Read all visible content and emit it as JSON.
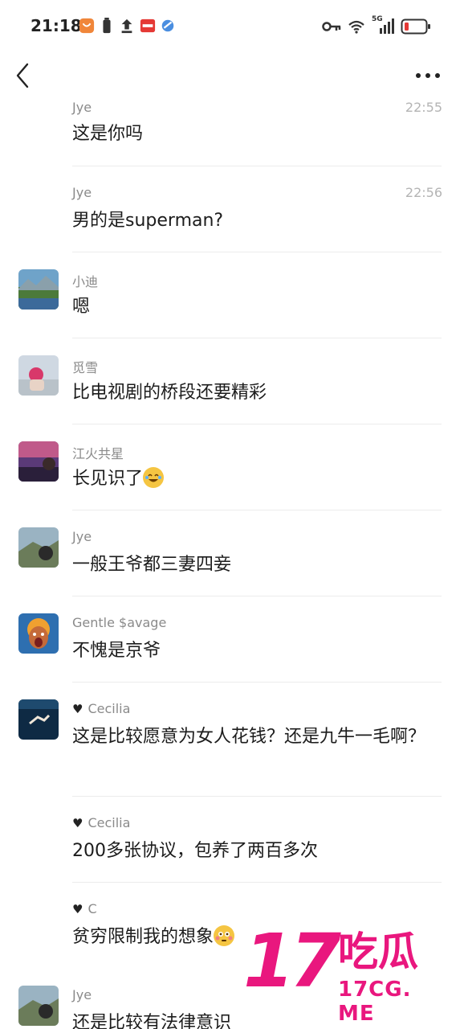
{
  "status_bar": {
    "time": "21:18",
    "network": "5G"
  },
  "nav": {
    "back_icon": "chevron-left-icon",
    "more_icon": "more-dots-icon"
  },
  "messages": [
    {
      "name": "Jye",
      "time": "22:55",
      "text": "这是你吗",
      "avatar": false,
      "heart": false
    },
    {
      "name": "Jye",
      "time": "22:56",
      "text": "男的是superman?",
      "avatar": false,
      "heart": false
    },
    {
      "name": "小迪",
      "text": "嗯",
      "avatar": true,
      "heart": false
    },
    {
      "name": "觅雪",
      "text": "比电视剧的桥段还要精彩",
      "avatar": true,
      "heart": false
    },
    {
      "name": "江火共星",
      "text": "长见识了",
      "emoji": "rolling-laughing-emoji",
      "avatar": true,
      "heart": false
    },
    {
      "name": "Jye",
      "text": "一般王爷都三妻四妾",
      "avatar": true,
      "heart": false
    },
    {
      "name": "Gentle $avage",
      "text": "不愧是京爷",
      "avatar": true,
      "heart": false
    },
    {
      "name": "Cecilia",
      "text": "这是比较愿意为女人花钱？还是九牛一毛啊？",
      "avatar": true,
      "heart": true
    },
    {
      "name": "Cecilia",
      "text": "200多张协议，包养了两百多次",
      "avatar": false,
      "heart": true
    },
    {
      "name": "C",
      "text": "贫穷限制我的想象",
      "emoji": "flushed-emoji",
      "avatar": false,
      "heart": true
    },
    {
      "name": "Jye",
      "text": "还是比较有法律意识",
      "avatar": true,
      "heart": false
    }
  ],
  "watermark": {
    "number": "17",
    "chinese": "吃瓜",
    "url": "17CG. ME"
  },
  "colors": {
    "watermark": "#e9177e",
    "name": "#8a8a8a",
    "time": "#b4b4b4"
  }
}
